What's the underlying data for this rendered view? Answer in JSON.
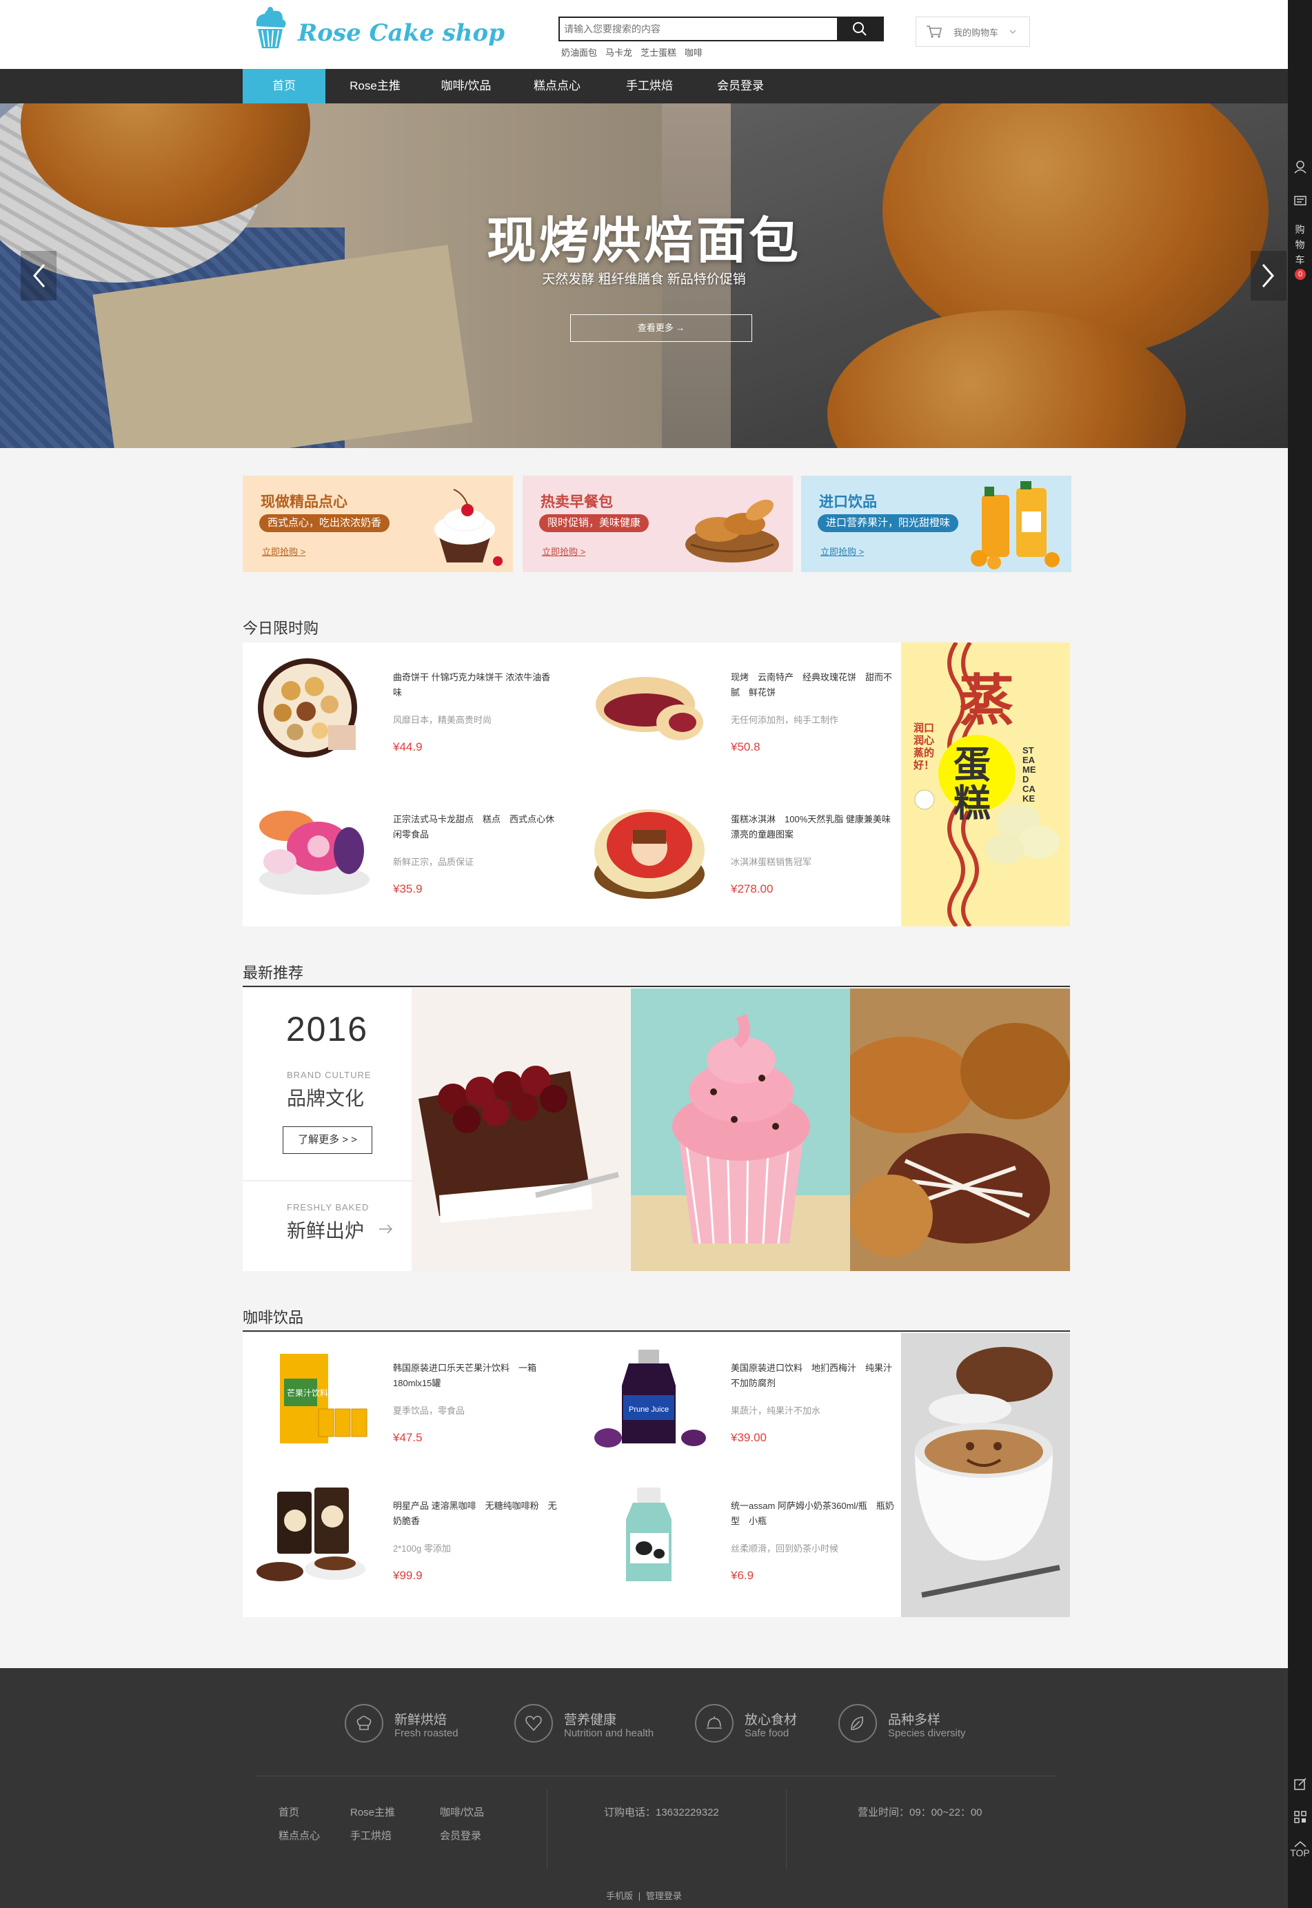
{
  "header": {
    "logo_text": "Rose Cake shop",
    "search_placeholder": "请输入您要搜索的内容",
    "hot_words": [
      "奶油面包",
      "马卡龙",
      "芝士蛋糕",
      "咖啡"
    ],
    "cart_label": "我的购物车"
  },
  "nav": {
    "items": [
      "首页",
      "Rose主推",
      "咖啡/饮品",
      "糕点点心",
      "手工烘焙",
      "会员登录"
    ],
    "active_color": "#3cb7d9"
  },
  "banner": {
    "title": "现烤烘焙面包",
    "subtitle": "天然发酵 粗纤维膳食 新品特价促销",
    "button": "查看更多 →"
  },
  "promos": [
    {
      "title": "现做精品点心",
      "tag": "西式点心，吃出浓浓奶香",
      "link": "立即抢购 >",
      "bg": "#fde3c3",
      "accent": "#b5601e"
    },
    {
      "title": "热卖早餐包",
      "tag": "限时促销，美味健康",
      "link": "立即抢购 >",
      "bg": "#f7dfe3",
      "accent": "#c6473e"
    },
    {
      "title": "进口饮品",
      "tag": "进口营养果汁，阳光甜橙味",
      "link": "立即抢购 >",
      "bg": "#cde8f5",
      "accent": "#2581b5"
    }
  ],
  "sections": {
    "flash": "今日限时购",
    "recommend": "最新推荐",
    "coffee": "咖啡饮品"
  },
  "flash_products": [
    {
      "name": "曲奇饼干 什锦巧克力味饼干 浓浓牛油香味",
      "desc": "风靡日本，精美高贵时尚",
      "price": "¥44.9"
    },
    {
      "name": "现烤　云南特产　经典玫瑰花饼　甜而不腻　鲜花饼",
      "desc": "无任何添加剂，纯手工制作",
      "price": "¥50.8"
    },
    {
      "name": "正宗法式马卡龙甜点　糕点　西式点心休闲零食品",
      "desc": "新鲜正宗，品质保证",
      "price": "¥35.9"
    },
    {
      "name": "蛋糕冰淇淋　100%天然乳脂 健康兼美味漂亮的童趣图案",
      "desc": "冰淇淋蛋糕销售冠军",
      "price": "¥278.00"
    }
  ],
  "flash_ad": {
    "big_chars": "蒸",
    "cake_chars": "蛋糕",
    "side_text": "润口润心 蒸的好！",
    "en": "STEAMED CAKE"
  },
  "recommend": {
    "year": "2016",
    "brand_en": "BRAND CULTURE",
    "brand_cn": "品牌文化",
    "more": "了解更多 > >",
    "fresh_en": "FRESHLY BAKED",
    "fresh_cn": "新鲜出炉"
  },
  "coffee_products": [
    {
      "name": "韩国原装进口乐天芒果汁饮料　一箱180mlx15罐",
      "desc": "夏季饮品，零食品",
      "price": "¥47.5",
      "label": "芒果汁饮料"
    },
    {
      "name": "美国原装进口饮料　地扪西梅汁　纯果汁不加防腐剂",
      "desc": "果蔬汁，纯果汁不加水",
      "price": "¥39.00",
      "label": "Prune Juice"
    },
    {
      "name": "明星产品 速溶黑咖啡　无糖纯咖啡粉　无奶脆香",
      "desc": "2*100g 零添加",
      "price": "¥99.9"
    },
    {
      "name": "统一assam 阿萨姆小奶茶360ml/瓶　瓶奶型　小瓶",
      "desc": "丝柔顺滑，回到奶茶小时候",
      "price": "¥6.9"
    }
  ],
  "footer": {
    "features": [
      {
        "cn": "新鲜烘焙",
        "en": "Fresh roasted",
        "icon": "chef-hat-icon"
      },
      {
        "cn": "营养健康",
        "en": "Nutrition and health",
        "icon": "heart-icon"
      },
      {
        "cn": "放心食材",
        "en": "Safe food",
        "icon": "cloche-icon"
      },
      {
        "cn": "品种多样",
        "en": "Species diversity",
        "icon": "leaf-icon"
      }
    ],
    "links": [
      "首页",
      "Rose主推",
      "咖啡/饮品",
      "糕点点心",
      "手工烘焙",
      "会员登录"
    ],
    "phone": "订购电话：13632229322",
    "hours": "营业时间：09：00~22：00",
    "bottom_mobile": "手机版",
    "bottom_admin": "管理登录"
  },
  "sidebar": {
    "cart_label": [
      "购",
      "物",
      "车"
    ],
    "cart_count": "0",
    "top_label": "TOP"
  }
}
